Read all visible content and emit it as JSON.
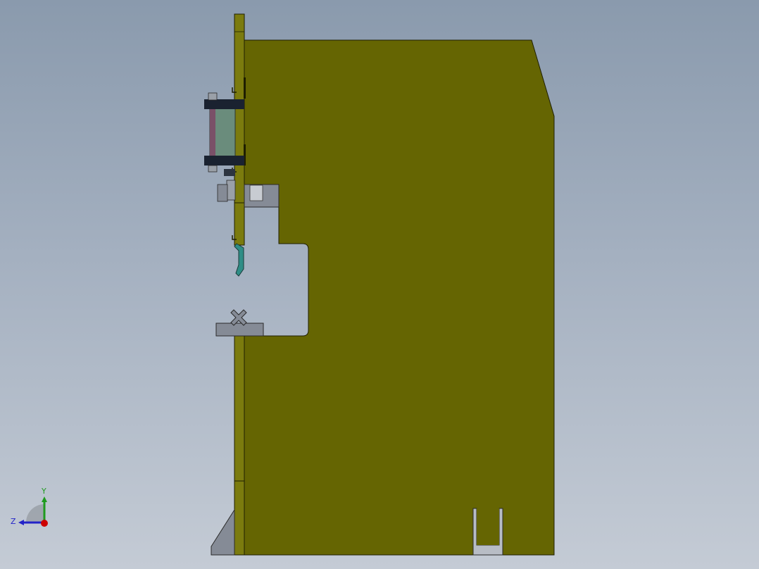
{
  "app": {
    "type": "cad-viewport",
    "view": "side"
  },
  "colors": {
    "background_top": "#8a9aad",
    "background_bottom": "#c4cbd5",
    "frame_body": "#656502",
    "frame_plate": "#7b7b0e",
    "outline": "#1e1e00",
    "tooling_grey": "#858b96",
    "cylinder": "#6a8c7c",
    "clamp_block": "#1a2230",
    "punch_teal": "#2f8d86",
    "axis_x": "#cc0000",
    "axis_y": "#1f9b1f",
    "axis_z": "#2323c8"
  },
  "triad": {
    "y_label": "Y",
    "z_label": "Z"
  }
}
